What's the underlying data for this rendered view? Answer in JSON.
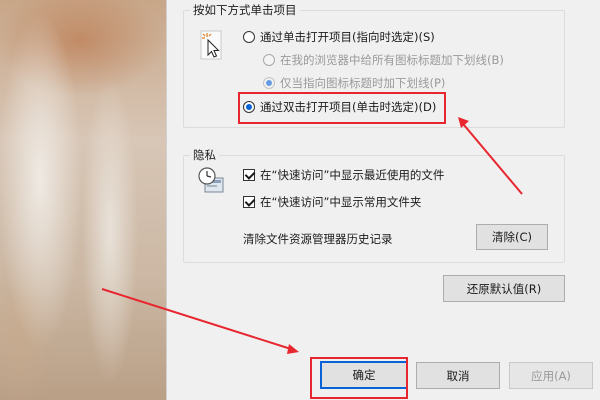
{
  "click_items": {
    "group_title": "按如下方式单击项目",
    "single_click": "通过单击打开项目(指向时选定)(S)",
    "underline_all": "在我的浏览器中给所有图标标题加下划线(B)",
    "underline_hover": "仅当指向图标标题时加下划线(P)",
    "double_click": "通过双击打开项目(单击时选定)(D)",
    "selected_option": "double_click"
  },
  "privacy": {
    "group_title": "隐私",
    "show_recent": "在“快速访问”中显示最近使用的文件",
    "show_recent_checked": true,
    "show_frequent": "在“快速访问”中显示常用文件夹",
    "show_frequent_checked": true,
    "clear_history_label": "清除文件资源管理器历史记录",
    "clear_button": "清除(C)"
  },
  "restore_defaults": "还原默认值(R)",
  "footer": {
    "ok": "确定",
    "cancel": "取消",
    "apply": "应用(A)"
  },
  "colors": {
    "annotation": "#e8262f",
    "accent": "#0a63d6"
  },
  "icons": [
    "cursor-click-icon",
    "privacy-clock-icon"
  ]
}
